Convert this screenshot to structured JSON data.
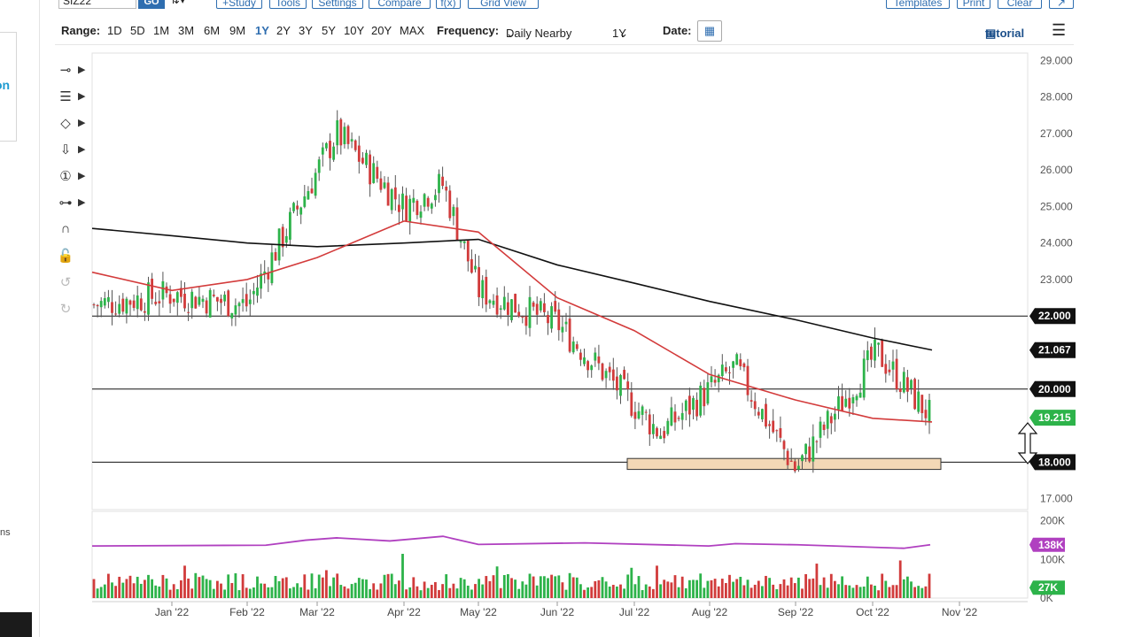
{
  "toolbar": {
    "symbol": "SIZ22",
    "go_label": "GO",
    "study_label": "+Study",
    "tools_label": "Tools",
    "settings_label": "Settings",
    "compare_label": "Compare",
    "fx_label": "f(x)",
    "grid_view_label": "Grid View",
    "templates_label": "Templates",
    "print_label": "Print",
    "clear_label": "Clear"
  },
  "rangebar": {
    "range_label": "Range:",
    "ranges": [
      "1D",
      "5D",
      "1M",
      "3M",
      "6M",
      "9M",
      "1Y",
      "2Y",
      "3Y",
      "5Y",
      "10Y",
      "20Y",
      "MAX"
    ],
    "active_range": "1Y",
    "frequency_label": "Frequency:",
    "frequency_value": "Daily Nearby",
    "period_value": "1Y",
    "date_label": "Date:",
    "tutorial_label": "tutorial"
  },
  "sidebar": {
    "card_text": "on",
    "side_text": "ns"
  },
  "chart_data": {
    "type": "candlestick",
    "price_ylim": [
      16.7,
      29.2
    ],
    "price_ticks": [
      "29.000",
      "28.000",
      "27.000",
      "26.000",
      "25.000",
      "24.000",
      "23.000",
      "22.000",
      "21.067",
      "20.000",
      "19.215",
      "18.000",
      "17.000"
    ],
    "x_ticks": [
      "Jan '22",
      "Feb '22",
      "Mar '22",
      "Apr '22",
      "May '22",
      "Jun '22",
      "Jul '22",
      "Aug '22",
      "Sep '22",
      "Oct '22",
      "Nov '22"
    ],
    "horizontal_lines": [
      22.0,
      20.0,
      18.0
    ],
    "support_zone": [
      17.8,
      18.1
    ],
    "markers": [
      {
        "label": "22.000",
        "value": 22.0,
        "color": "#111111"
      },
      {
        "label": "21.067",
        "value": 21.067,
        "color": "#111111"
      },
      {
        "label": "20.000",
        "value": 20.0,
        "color": "#111111"
      },
      {
        "label": "19.215",
        "value": 19.215,
        "color": "#2db34a"
      },
      {
        "label": "18.000",
        "value": 18.0,
        "color": "#111111"
      }
    ],
    "sma_long": [
      [
        "Dec '21",
        24.4
      ],
      [
        "Jan '22",
        24.2
      ],
      [
        "Feb '22",
        24.0
      ],
      [
        "Mar '22",
        23.9
      ],
      [
        "Apr '22",
        24.0
      ],
      [
        "May '22",
        24.1
      ],
      [
        "Jun '22",
        23.4
      ],
      [
        "Jul '22",
        22.9
      ],
      [
        "Aug '22",
        22.4
      ],
      [
        "Sep '22",
        21.9
      ],
      [
        "Oct '22",
        21.4
      ],
      [
        "Oct 22 end",
        21.07
      ]
    ],
    "sma_short": [
      [
        "Dec '21",
        23.2
      ],
      [
        "Jan '22",
        22.7
      ],
      [
        "Feb '22",
        23.0
      ],
      [
        "Mar '22",
        23.6
      ],
      [
        "Apr '22",
        24.6
      ],
      [
        "May '22",
        24.3
      ],
      [
        "Jun '22",
        22.5
      ],
      [
        "Jul '22",
        21.6
      ],
      [
        "Aug '22",
        20.4
      ],
      [
        "Sep '22",
        19.7
      ],
      [
        "Oct '22",
        19.2
      ],
      [
        "Oct 22 end",
        19.1
      ]
    ],
    "price_path": [
      [
        "Dec '21",
        22.3
      ],
      [
        "Jan '22",
        22.6
      ],
      [
        "Feb '22",
        22.3
      ],
      [
        "Mar '22",
        27.0
      ],
      [
        "Apr '22",
        25.0
      ],
      [
        "Apr '22 end",
        25.6
      ],
      [
        "May '22",
        22.7
      ],
      [
        "Jun '22",
        21.8
      ],
      [
        "Jul '22",
        18.8
      ],
      [
        "Aug '22",
        20.6
      ],
      [
        "Sep '22",
        17.8
      ],
      [
        "Oct '22",
        21.0
      ],
      [
        "Oct 22 end",
        19.2
      ]
    ],
    "volume_ylim": [
      0,
      220000
    ],
    "volume_ticks": [
      "200K",
      "100K",
      "0K"
    ],
    "volume_last": "27K",
    "open_interest_last": "138K",
    "colors": {
      "up": "#2db34a",
      "down": "#d13b3b",
      "sma_short": "#d33b3b",
      "sma_long": "#111111",
      "open_interest": "#b040c0",
      "zone": "#f3d8b6"
    }
  }
}
